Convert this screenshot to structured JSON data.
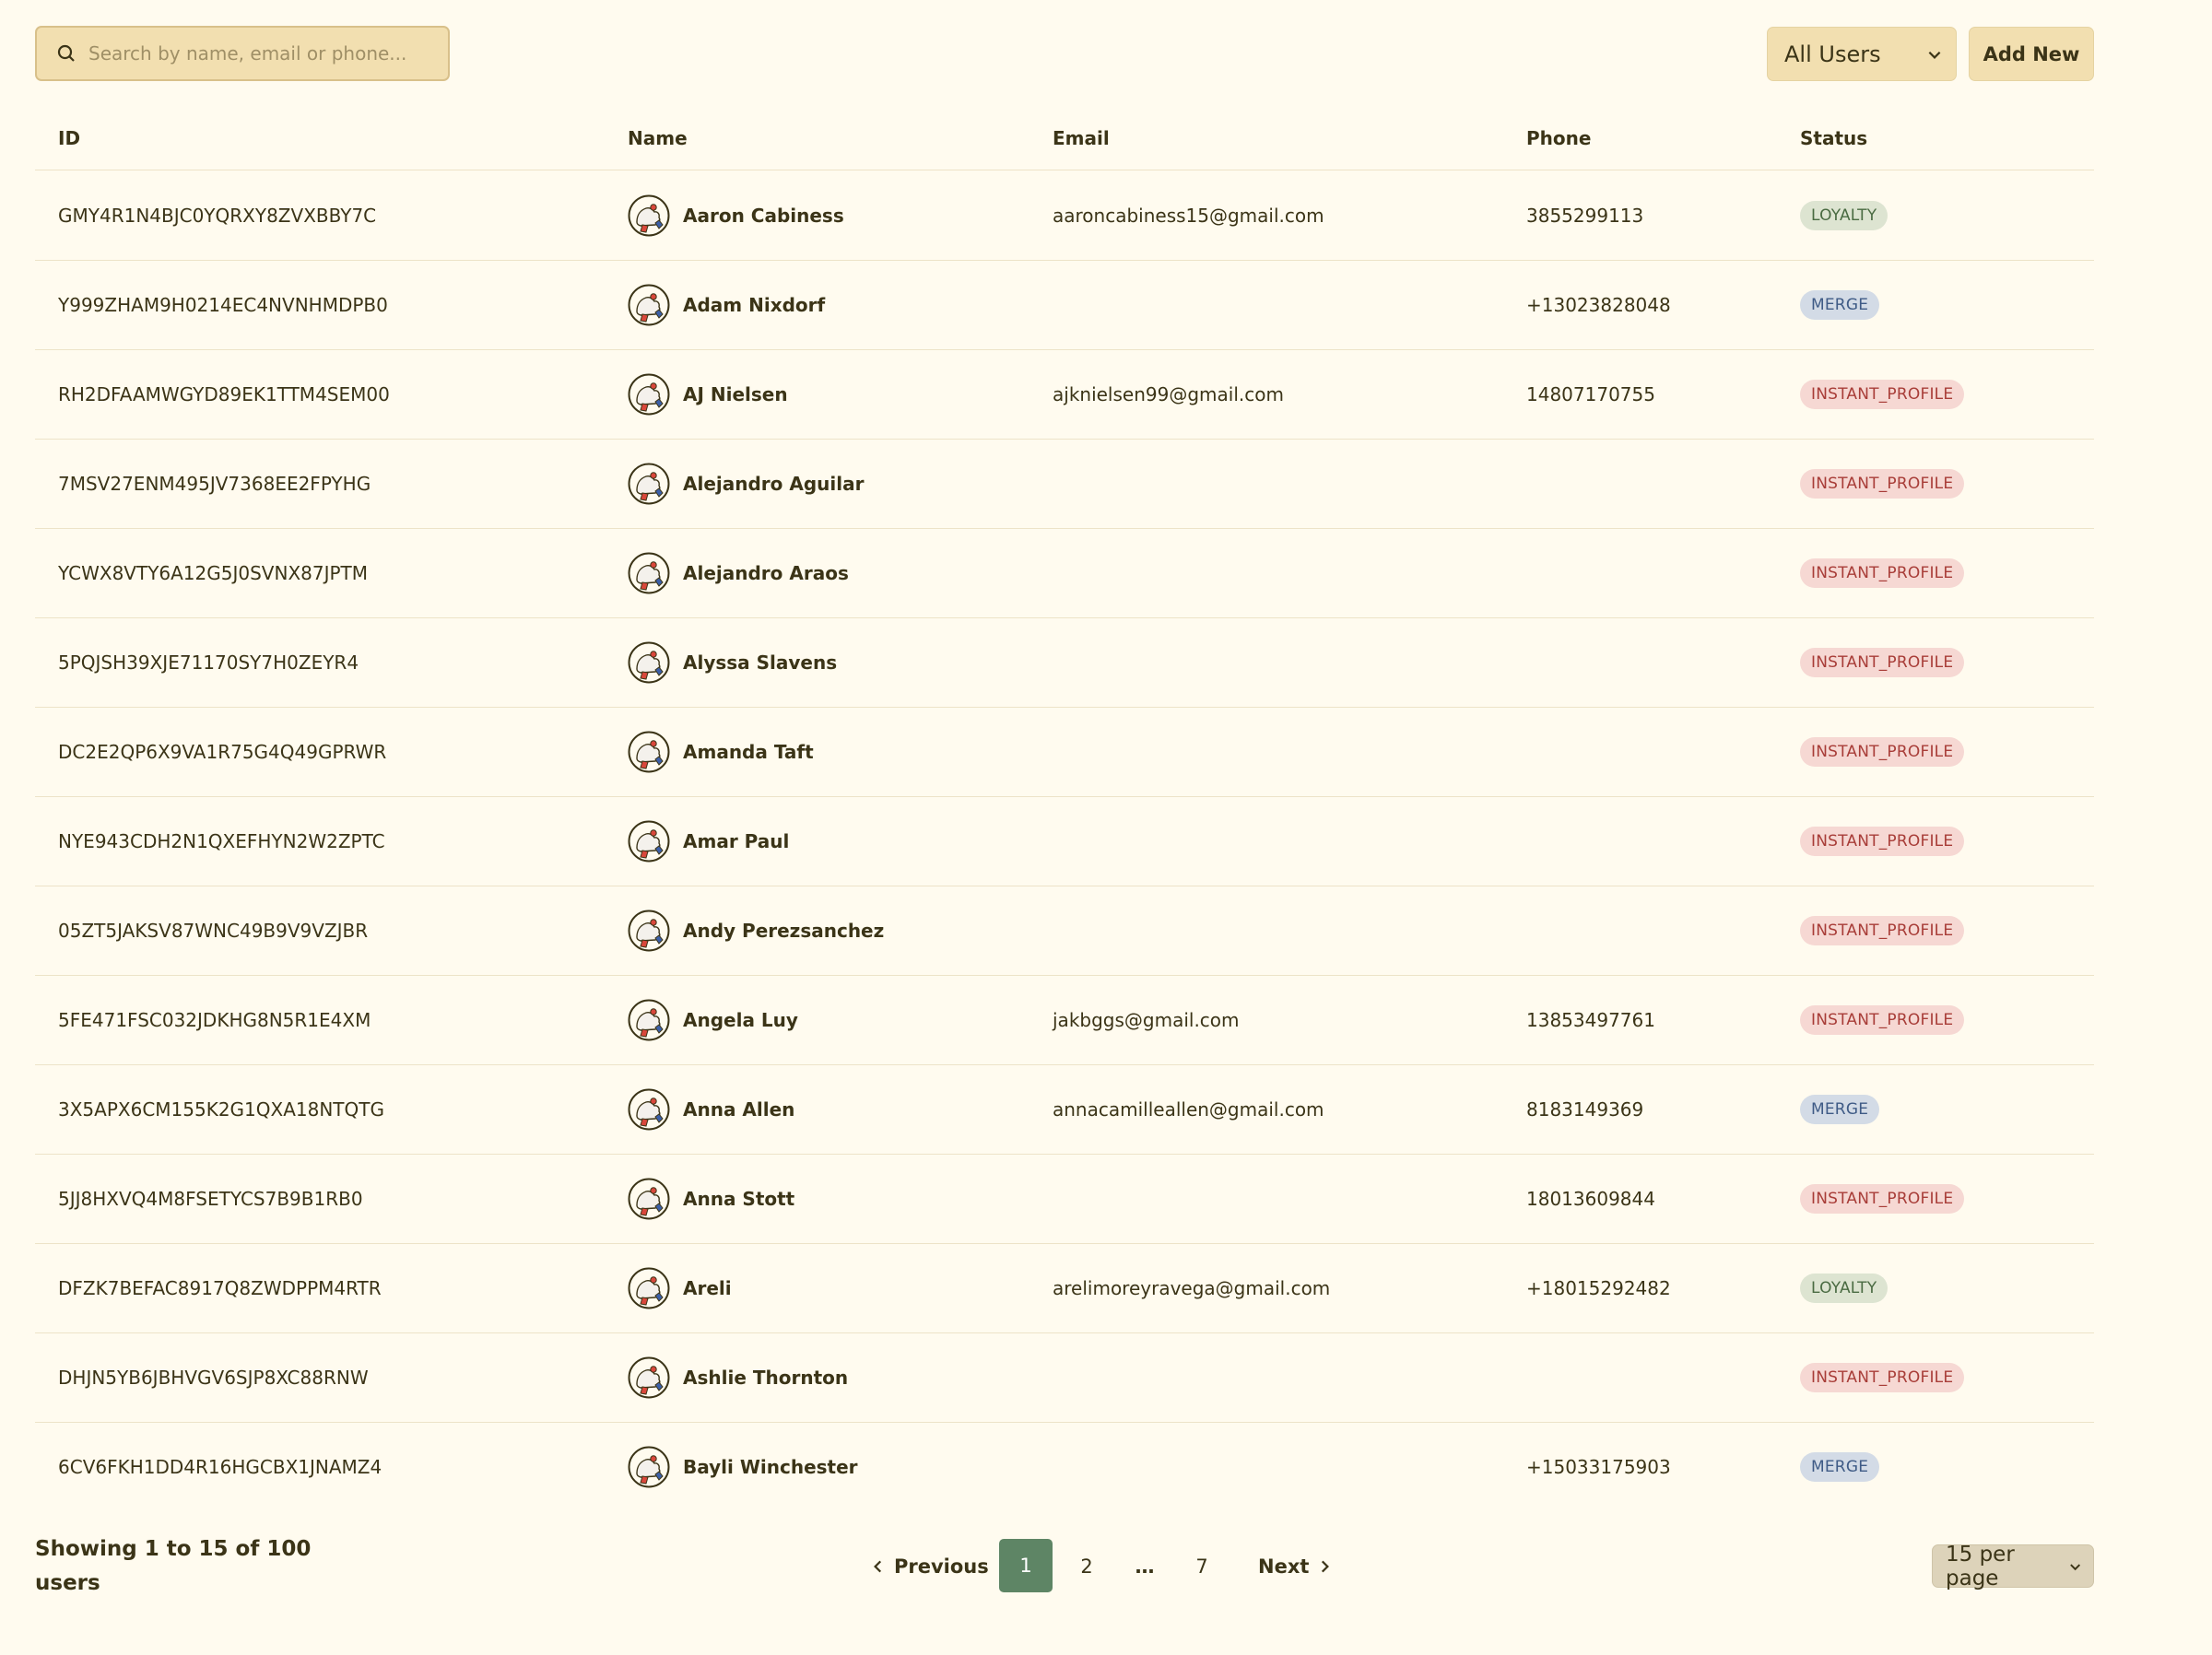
{
  "search": {
    "placeholder": "Search by name, email or phone..."
  },
  "filter": {
    "selected": "All Users"
  },
  "add_button": "Add New",
  "columns": {
    "id": "ID",
    "name": "Name",
    "email": "Email",
    "phone": "Phone",
    "status": "Status"
  },
  "rows": [
    {
      "id": "GMY4R1N4BJC0YQRXY8ZVXBBY7C",
      "name": "Aaron Cabiness",
      "email": "aaroncabiness15@gmail.com",
      "phone": "3855299113",
      "status": "LOYALTY"
    },
    {
      "id": "Y999ZHAM9H0214EC4NVNHMDPB0",
      "name": "Adam Nixdorf",
      "email": "",
      "phone": "+13023828048",
      "status": "MERGE"
    },
    {
      "id": "RH2DFAAMWGYD89EK1TTM4SEM00",
      "name": "AJ Nielsen",
      "email": "ajknielsen99@gmail.com",
      "phone": "14807170755",
      "status": "INSTANT_PROFILE"
    },
    {
      "id": "7MSV27ENM495JV7368EE2FPYHG",
      "name": "Alejandro Aguilar",
      "email": "",
      "phone": "",
      "status": "INSTANT_PROFILE"
    },
    {
      "id": "YCWX8VTY6A12G5J0SVNX87JPTM",
      "name": "Alejandro Araos",
      "email": "",
      "phone": "",
      "status": "INSTANT_PROFILE"
    },
    {
      "id": "5PQJSH39XJE71170SY7H0ZEYR4",
      "name": "Alyssa Slavens",
      "email": "",
      "phone": "",
      "status": "INSTANT_PROFILE"
    },
    {
      "id": "DC2E2QP6X9VA1R75G4Q49GPRWR",
      "name": "Amanda Taft",
      "email": "",
      "phone": "",
      "status": "INSTANT_PROFILE"
    },
    {
      "id": "NYE943CDH2N1QXEFHYN2W2ZPTC",
      "name": "Amar Paul",
      "email": "",
      "phone": "",
      "status": "INSTANT_PROFILE"
    },
    {
      "id": "05ZT5JAKSV87WNC49B9V9VZJBR",
      "name": "Andy Perezsanchez",
      "email": "",
      "phone": "",
      "status": "INSTANT_PROFILE"
    },
    {
      "id": "5FE471FSC032JDKHG8N5R1E4XM",
      "name": "Angela Luy",
      "email": "jakbggs@gmail.com",
      "phone": "13853497761",
      "status": "INSTANT_PROFILE"
    },
    {
      "id": "3X5APX6CM155K2G1QXA18NTQTG",
      "name": "Anna Allen",
      "email": "annacamilleallen@gmail.com",
      "phone": "8183149369",
      "status": "MERGE"
    },
    {
      "id": "5JJ8HXVQ4M8FSETYCS7B9B1RB0",
      "name": "Anna Stott",
      "email": "",
      "phone": "18013609844",
      "status": "INSTANT_PROFILE"
    },
    {
      "id": "DFZK7BEFAC8917Q8ZWDPPM4RTR",
      "name": "Areli",
      "email": "arelimoreyravega@gmail.com",
      "phone": "+18015292482",
      "status": "LOYALTY"
    },
    {
      "id": "DHJN5YB6JBHVGV6SJP8XC88RNW",
      "name": "Ashlie Thornton",
      "email": "",
      "phone": "",
      "status": "INSTANT_PROFILE"
    },
    {
      "id": "6CV6FKH1DD4R16HGCBX1JNAMZ4",
      "name": "Bayli Winchester",
      "email": "",
      "phone": "+15033175903",
      "status": "MERGE"
    }
  ],
  "footer": {
    "showing": "Showing 1 to 15 of 100 users",
    "previous": "Previous",
    "next": "Next",
    "pages": [
      "1",
      "2",
      "…",
      "7"
    ],
    "current_page": "1",
    "per_page": "15 per page"
  },
  "colors": {
    "background": "#fffbef",
    "active_page": "#5e8565",
    "loyalty_badge": "#dde4d1",
    "merge_badge": "#d3dbe6",
    "instant_profile_badge": "#f6d8d3"
  }
}
